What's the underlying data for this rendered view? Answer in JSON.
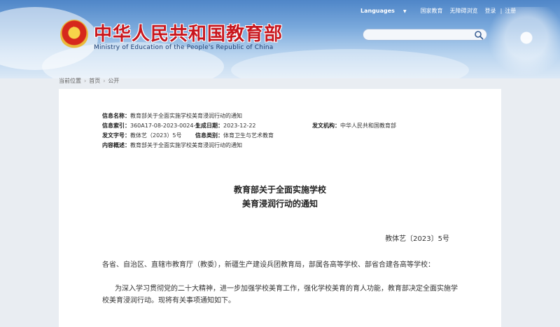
{
  "header": {
    "title": "中华人民共和国教育部",
    "subtitle": "Ministry of Education of the People's Republic of China",
    "top_links": [
      "Languages",
      "国家教育",
      "无障碍浏览",
      "登录",
      "注册"
    ],
    "search": {
      "placeholder": ""
    }
  },
  "breadcrumb": [
    "当前位置",
    "首页",
    "公开"
  ],
  "meta": {
    "name_label": "信息名称：",
    "name_value": "教育部关于全面实施学校美育浸润行动的通知",
    "index_label": "信息索引：",
    "index_value": "360A17-08-2023-0024-1",
    "date_label": "生成日期：",
    "date_value": "2023-12-22",
    "org_label": "发文机构：",
    "org_value": "中华人民共和国教育部",
    "docno_label": "发文字号：",
    "docno_value": "教体艺（2023）5号",
    "category_label": "信息类别：",
    "category_value": "体育卫生与艺术教育",
    "summary_label": "内容概述：",
    "summary_value": "教育部关于全面实施学校美育浸润行动的通知"
  },
  "document": {
    "title_line1": "教育部关于全面实施学校",
    "title_line2": "美育浸润行动的通知",
    "doc_number": "教体艺〔2023〕5号",
    "recipients": "各省、自治区、直辖市教育厅（教委），新疆生产建设兵团教育局，部属各高等学校、部省合建各高等学校：",
    "paragraph1": "为深入学习贯彻党的二十大精神，进一步加强学校美育工作，强化学校美育的育人功能，教育部决定全面实施学校美育浸润行动。现将有关事项通知如下。"
  },
  "colors": {
    "title_red": "#c8161d",
    "header_blue": "#4f86c8"
  }
}
